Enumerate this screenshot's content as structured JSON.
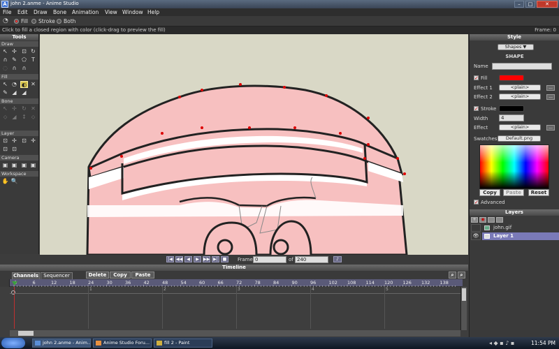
{
  "window": {
    "title": "john 2.anme - Anime Studio",
    "app_icon_letter": "A"
  },
  "menu": [
    "File",
    "Edit",
    "Draw",
    "Bone",
    "Animation",
    "View",
    "Window",
    "Help"
  ],
  "options": {
    "fill_label": "Fill",
    "stroke_label": "Stroke",
    "both_label": "Both",
    "selected": "Fill"
  },
  "status": {
    "hint": "Click to fill a closed region with color (click-drag to preview the fill)",
    "frame_readout": "Frame: 0"
  },
  "tools": {
    "title": "Tools",
    "sections": [
      "Draw",
      "Fill",
      "Bone",
      "Layer",
      "Camera",
      "Workspace"
    ],
    "draw_glyphs": [
      "↖",
      "✢",
      "⊡",
      "↻",
      "∩",
      "✎",
      "⬠",
      "T",
      "◌",
      "∩",
      "∩"
    ],
    "fill_glyphs": [
      "↖",
      "◔",
      "◐",
      "✕",
      "✎",
      "◢",
      "◢"
    ],
    "bone_glyphs": [
      "↖",
      "✢",
      "↻",
      "✕",
      "⬦",
      "◢",
      "↕",
      "⬦"
    ],
    "layer_glyphs": [
      "⊡",
      "✢",
      "⊡",
      "✛",
      "⊡",
      "⊡"
    ],
    "camera_glyphs": [
      "▣",
      "▣",
      "▣",
      "▣"
    ],
    "workspace_glyphs": [
      "✋",
      "🔍"
    ]
  },
  "framebar": {
    "frame_label": "Frame",
    "frame_value": "0",
    "of_label": "of",
    "total_value": "240",
    "buttons": [
      "|◀",
      "◀◀",
      "◀",
      "▶",
      "▶▶",
      "▶|",
      "■"
    ]
  },
  "timeline": {
    "title": "Timeline",
    "tabs": [
      "Channels",
      "Sequencer"
    ],
    "buttons": [
      "Delete",
      "Copy",
      "Paste"
    ],
    "ruler_labels": [
      "0",
      "6",
      "12",
      "18",
      "24",
      "30",
      "36",
      "42",
      "48",
      "54",
      "60",
      "66",
      "72",
      "78",
      "84",
      "90",
      "96",
      "102",
      "108",
      "114",
      "120",
      "126",
      "132",
      "138"
    ],
    "second_marks": [
      "1",
      "2",
      "3",
      "4",
      "5"
    ]
  },
  "style": {
    "title": "Style",
    "shapes_dropdown": "Shapes ▼",
    "section": "SHAPE",
    "name_label": "Name",
    "name_value": "",
    "fill_label": "Fill",
    "fill_color": "#ff0000",
    "effect1_label": "Effect 1",
    "effect1_value": "<plain>",
    "effect2_label": "Effect 2",
    "effect2_value": "<plain>",
    "stroke_label": "Stroke",
    "stroke_color": "#000000",
    "width_label": "Width",
    "width_value": "4",
    "effect_label": "Effect",
    "effect_value": "<plain>",
    "swatches_label": "Swatches",
    "swatches_value": "Default.png",
    "copy_label": "Copy",
    "paste_label": "Paste",
    "reset_label": "Reset",
    "advanced_label": "Advanced",
    "dots_label": "..."
  },
  "layers": {
    "title": "Layers",
    "items": [
      {
        "name": "john.gif",
        "selected": false
      },
      {
        "name": "Layer 1",
        "selected": true
      }
    ]
  },
  "taskbar": {
    "tasks": [
      "john 2.anme - Anim...",
      "Anime Studio Foru...",
      "fill 2 - Paint"
    ],
    "clock": "11:54 PM"
  }
}
